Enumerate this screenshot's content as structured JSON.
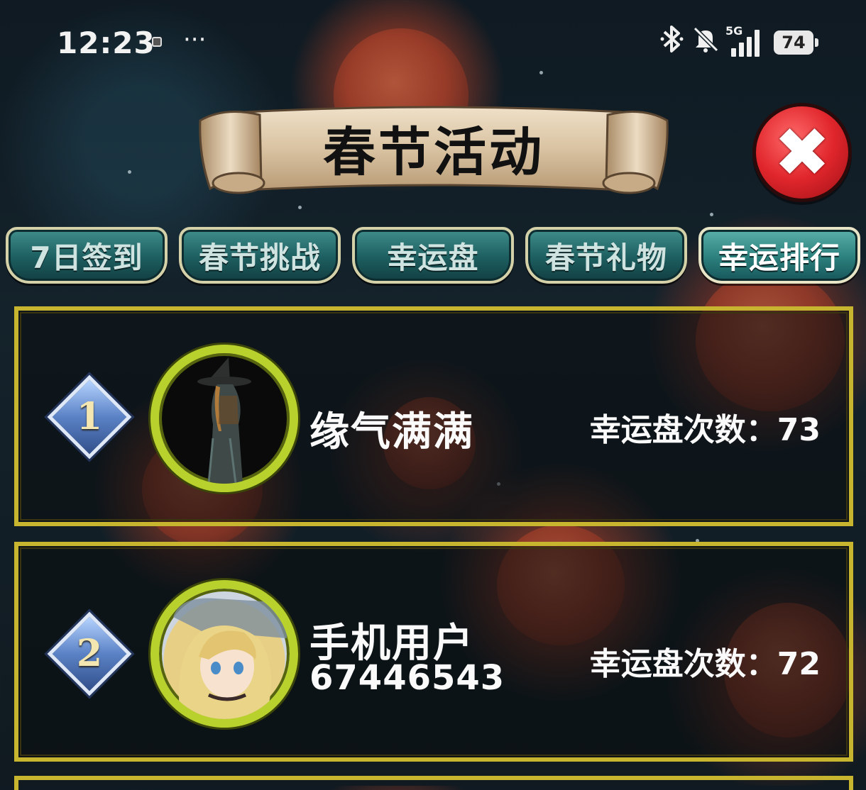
{
  "status_bar": {
    "time": "12:23",
    "notification_icon": "square-notification-icon",
    "more_icon": "ellipsis-icon",
    "more_text": "···",
    "bluetooth_icon": "bluetooth-icon",
    "mute_icon": "bell-off-icon",
    "network_label": "5G",
    "battery_level": "74"
  },
  "header": {
    "title": "春节活动",
    "close_icon": "close-x-icon"
  },
  "tabs": [
    {
      "label": "7日签到",
      "active": false
    },
    {
      "label": "春节挑战",
      "active": false
    },
    {
      "label": "幸运盘",
      "active": false
    },
    {
      "label": "春节礼物",
      "active": false
    },
    {
      "label": "幸运排行",
      "active": true
    }
  ],
  "ranking": [
    {
      "rank": "1",
      "name": "缘气满满",
      "id_line": "",
      "count_text": "幸运盘次数：73",
      "avatar": "witch-character-avatar"
    },
    {
      "rank": "2",
      "name": "手机用户",
      "id_line": "67446543",
      "count_text": "幸运盘次数：72",
      "avatar": "blonde-girl-avatar"
    }
  ],
  "colors": {
    "frame_gold": "#c7b530",
    "tab_teal": "#2b7f7c",
    "close_red": "#e0262c",
    "avatar_ring": "#b8d12c"
  }
}
